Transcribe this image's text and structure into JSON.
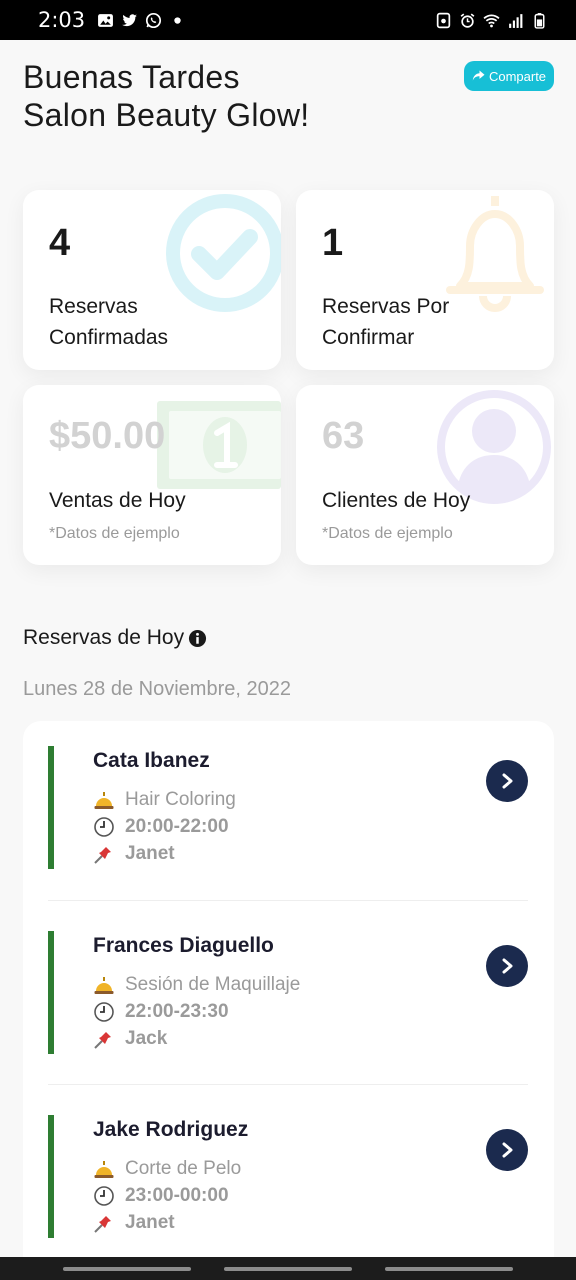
{
  "status_bar": {
    "time": "2:03",
    "notif_icons": [
      "gallery-icon",
      "twitter-icon",
      "whatsapp-icon",
      "dot-icon"
    ],
    "sys_icons": [
      "screenshot-icon",
      "alarm-icon",
      "wifi-icon",
      "signal-icon",
      "battery-icon"
    ]
  },
  "header": {
    "greeting_line1": "Buenas Tardes",
    "greeting_line2": "Salon Beauty Glow!",
    "share_label": "Comparte"
  },
  "stats": [
    {
      "value": "4",
      "label_line1": "Reservas",
      "label_line2": "Confirmadas",
      "icon": "check-circle-icon",
      "icon_color": "#d9f3f8"
    },
    {
      "value": "1",
      "label_line1": "Reservas Por",
      "label_line2": "Confirmar",
      "icon": "bell-icon",
      "icon_color": "#fdf1dd"
    },
    {
      "value": "$50.00",
      "label_line1": "Ventas de Hoy",
      "note": "*Datos de ejemplo",
      "icon": "money-icon",
      "icon_color": "#e6f3e6"
    },
    {
      "value": "63",
      "label_line1": "Clientes de Hoy",
      "note": "*Datos de ejemplo",
      "icon": "user-icon",
      "icon_color": "#ece8f8"
    }
  ],
  "reservations_section": {
    "title": "Reservas de Hoy",
    "date": "Lunes 28 de Noviembre, 2022",
    "items": [
      {
        "name": "Cata Ibanez",
        "service": "Hair Coloring",
        "time": "20:00-22:00",
        "staff": "Janet"
      },
      {
        "name": "Frances Diaguello",
        "service": "Sesión de Maquillaje",
        "time": "22:00-23:30",
        "staff": "Jack"
      },
      {
        "name": "Jake Rodriguez",
        "service": "Corte de Pelo",
        "time": "23:00-00:00",
        "staff": "Janet"
      }
    ]
  },
  "colors": {
    "accent": "#17bfd6",
    "status_bar_indicator": "#2e7d32",
    "go_button": "#1b2a4e"
  }
}
